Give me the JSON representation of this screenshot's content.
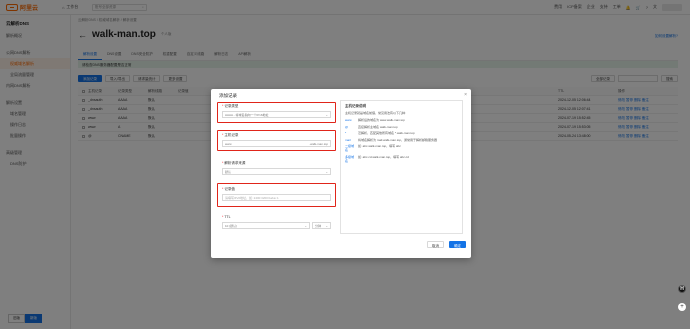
{
  "topbar": {
    "logo": "阿里云",
    "workspace": "工作台",
    "search_placeholder": "账号全部资源",
    "menu": [
      "费用",
      "ICP备案",
      "企业",
      "支持",
      "工单"
    ]
  },
  "sidebar": {
    "title": "云解析DNS",
    "items": [
      {
        "label": "解析概况",
        "sub": false,
        "active": false
      },
      {
        "label": "公网DNS解析",
        "sub": false,
        "active": false
      },
      {
        "label": "权威域名解析",
        "sub": true,
        "active": true
      },
      {
        "label": "全局流量管理",
        "sub": true,
        "active": false
      },
      {
        "label": "内网DNS解析",
        "sub": false,
        "active": false
      },
      {
        "label": "解析设置",
        "sub": false,
        "active": false
      },
      {
        "label": "域名管理",
        "sub": true,
        "active": false
      },
      {
        "label": "操作日志",
        "sub": true,
        "active": false
      },
      {
        "label": "批量操作",
        "sub": true,
        "active": false
      },
      {
        "label": "高级管理",
        "sub": false,
        "active": false
      },
      {
        "label": "DNS防护",
        "sub": true,
        "active": false
      }
    ],
    "bottom_toggle": [
      "旧版",
      "新版"
    ]
  },
  "main": {
    "breadcrumb": "云解析DNS / 权威域名解析 / 解析设置",
    "title": "walk-man.top",
    "badge": "个人版",
    "help_link": "如何设置解析?",
    "tabs": [
      "解析设置",
      "DNS设置",
      "DNS安全防护",
      "权重配置",
      "自定义线路",
      "解析日志",
      "API解析"
    ],
    "notice": "请检查DNS服务器配置是否正常",
    "toolbar": {
      "add": "添加记录",
      "import": "导入/导出",
      "request": "请求量统计",
      "more": "更多设置",
      "all_records": "全部记录",
      "search_btn": "搜索"
    },
    "table": {
      "headers": [
        "主机记录",
        "记录类型",
        "解析线路",
        "记录值",
        "TTL",
        "操作"
      ],
      "rows": [
        {
          "host": "_dnsauth",
          "type": "AAAA",
          "line": "默认",
          "ttl": "2024-12-05 12:06:44",
          "ops": "修改 暂停 删除 备注"
        },
        {
          "host": "_dnsauth",
          "type": "AAAA",
          "line": "默认",
          "ttl": "2024-12-05 12:07:41",
          "ops": "修改 暂停 删除 备注"
        },
        {
          "host": "www",
          "type": "AAAA",
          "line": "默认",
          "ttl": "2024-07-19 15:52:45",
          "ops": "修改 暂停 删除 备注"
        },
        {
          "host": "www",
          "type": "A",
          "line": "默认",
          "ttl": "2024-07-19 15:53:05",
          "ops": "修改 暂停 删除 备注"
        },
        {
          "host": "@",
          "type": "CNAME",
          "line": "默认",
          "ttl": "2024-05-24 13:48:00",
          "ops": "修改 暂停 删除 备注"
        }
      ]
    }
  },
  "dialog": {
    "title": "添加记录",
    "close": "×",
    "record_type_label": "记录类型",
    "record_type_value": "AAAA - 将域名指向一个IPv6地址",
    "host_label": "主机记录",
    "host_value": "www",
    "host_suffix": ".walk-man.top",
    "line_label": "解析请求来源",
    "line_value": "默认",
    "value_label": "记录值",
    "value_placeholder": "请填写IPv6地址，如: 2400:3200:baba::1",
    "ttl_label": "TTL",
    "ttl_value": "10 (默认)",
    "ttl_unit": "分钟",
    "help": {
      "title": "主机记录说明",
      "subtitle": "主机记录就是域名前缀，常见用法有以下几种:",
      "rows": [
        {
          "k": "www",
          "v": "解析后的域名为 www.walk-man.top"
        },
        {
          "k": "@",
          "v": "直接解析主域名 walk-man.top"
        },
        {
          "k": "*",
          "v": "泛解析，匹配其他所有域名 *.walk-man.top"
        },
        {
          "k": "mail",
          "v": "将域名解析为 mail.walk-man.top，通常用于解析邮箱服务器"
        },
        {
          "k": "二级域名",
          "v": "如: abc.walk-man.top，填写 abc"
        },
        {
          "k": "多级域名",
          "v": "如: abc.cd.walk-man.top，填写 abc.cd"
        }
      ]
    },
    "cancel": "取消",
    "ok": "确定"
  },
  "floats": {
    "h": "H",
    "plus": "+"
  }
}
